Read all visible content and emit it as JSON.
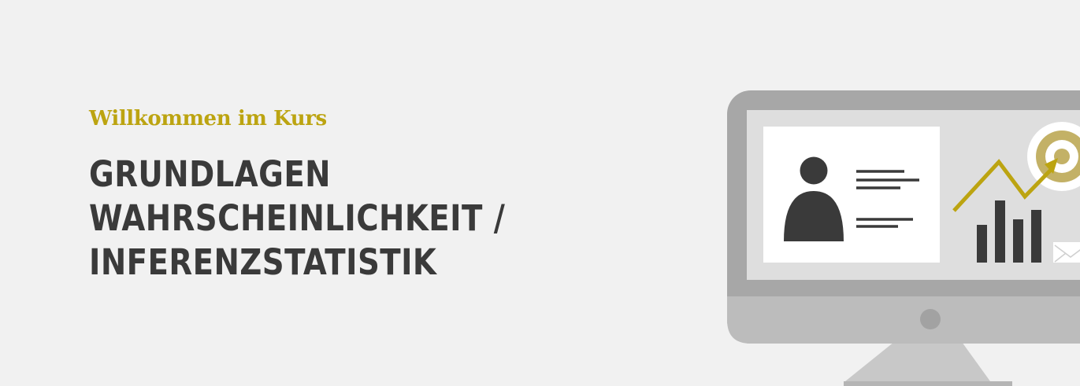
{
  "hero": {
    "kicker": "Willkommen im Kurs",
    "title_lines": [
      "GRUNDLAGEN",
      "WAHRSCHEINLICHKEIT /",
      "INFERENZSTATISTIK"
    ]
  },
  "colors": {
    "background": "#f1f1f1",
    "accent": "#bca411",
    "title_text": "#3a3a3a",
    "monitor_frame": "#a7a7a7",
    "monitor_bezel_bottom": "#bcbcbc",
    "screen": "#dedede",
    "dark_icon": "#3a3a3a"
  },
  "illustration": {
    "icons": [
      "monitor-icon",
      "person-icon",
      "text-lines-icon",
      "trend-arrow-icon",
      "bar-chart-icon",
      "target-icon",
      "envelope-icon"
    ]
  }
}
